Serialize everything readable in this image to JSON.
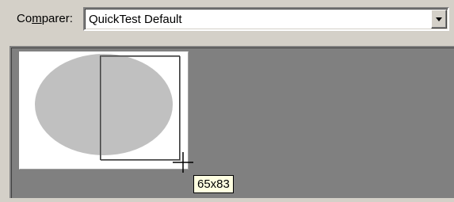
{
  "comparer": {
    "label_prefix": "Co",
    "label_mnemonic": "m",
    "label_suffix": "parer:",
    "selected_value": "QuickTest Default"
  },
  "selection": {
    "size_tooltip": "65x83"
  },
  "colors": {
    "window_bg": "#d4d0c8",
    "canvas_bg": "#808080",
    "thumbnail_bg": "#ffffff",
    "ellipse_fill": "#c0c0c0",
    "tooltip_bg": "#ffffe1"
  },
  "icons": {
    "dropdown": "chevron-down-icon",
    "cursor": "crosshair-cursor-icon"
  }
}
